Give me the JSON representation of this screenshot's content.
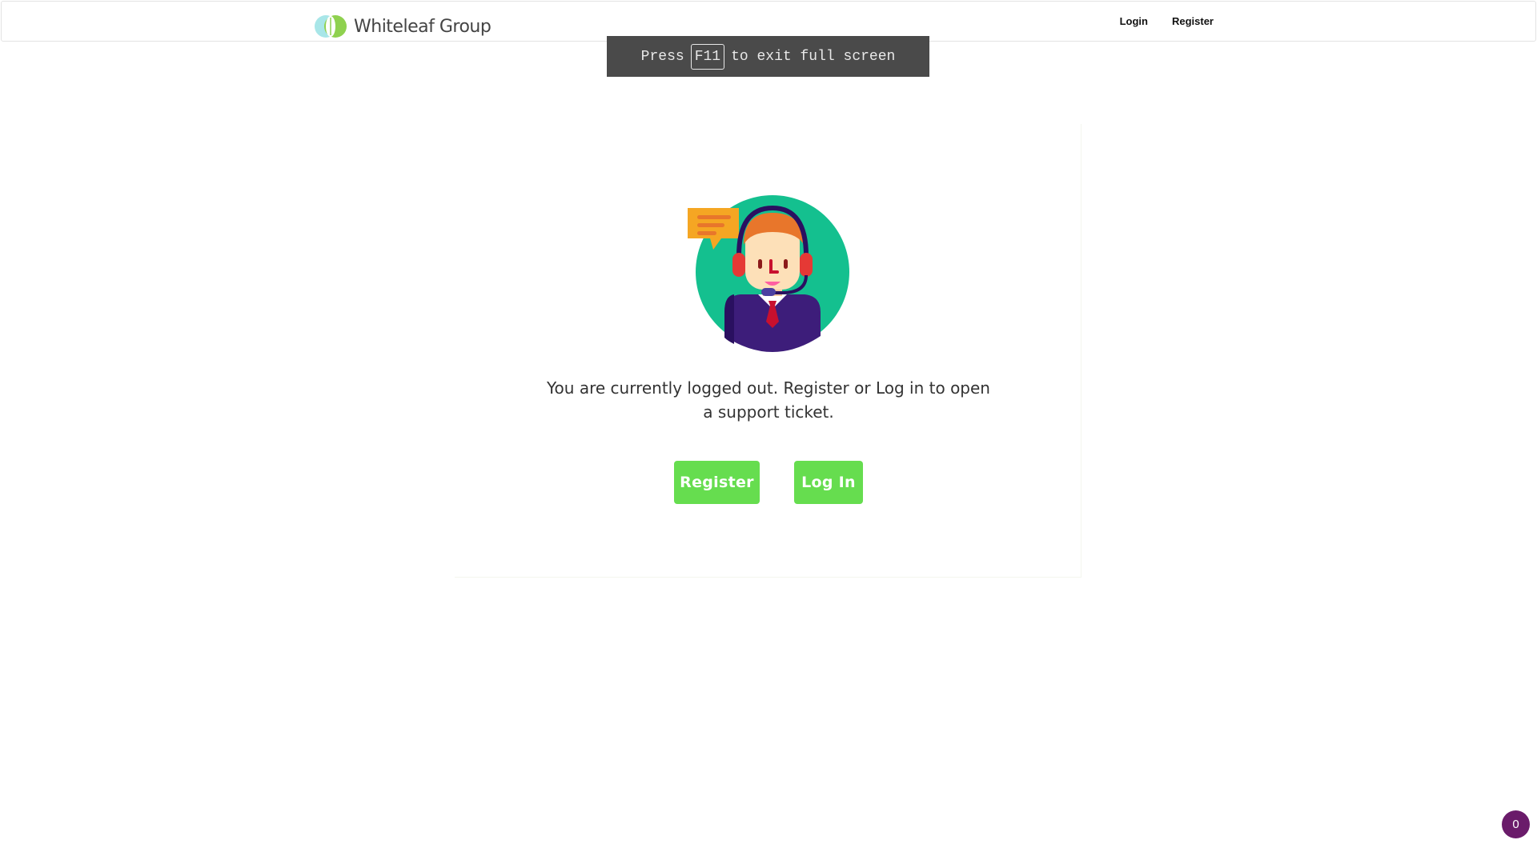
{
  "header": {
    "brand_name": "Whiteleaf Group",
    "nav": {
      "login_label": "Login",
      "register_label": "Register"
    }
  },
  "fullscreen_notice": {
    "prefix": "Press",
    "key": "F11",
    "suffix": "to exit full screen"
  },
  "support": {
    "illustration_icon": "support-agent-icon",
    "message": "You are currently logged out. Register or Log in to open a support ticket.",
    "register_button": "Register",
    "login_button": "Log In"
  },
  "floating_badge": {
    "count": "0"
  },
  "colors": {
    "accent_green": "#66dd4f",
    "badge_purple": "#6a1b6a",
    "notice_bg": "#4a4a4a"
  }
}
